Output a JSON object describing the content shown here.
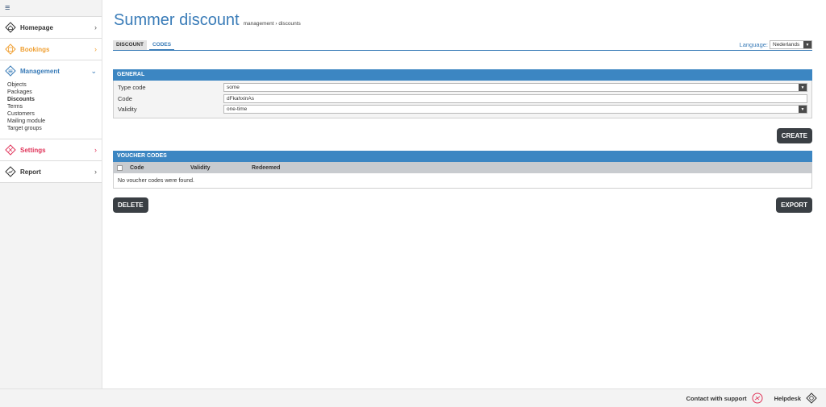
{
  "sidebar": {
    "items": [
      {
        "label": "Homepage",
        "color": "#333333",
        "icon": "home-icon"
      },
      {
        "label": "Bookings",
        "color": "#f0a033",
        "icon": "calendar-icon"
      },
      {
        "label": "Management",
        "color": "#3a7cb8",
        "icon": "management-icon",
        "subitems": [
          "Objects",
          "Packages",
          "Discounts",
          "Terms",
          "Customers",
          "Mailing module",
          "Target groups"
        ],
        "active_subitem": "Discounts"
      },
      {
        "label": "Settings",
        "color": "#e0355a",
        "icon": "settings-icon"
      },
      {
        "label": "Report",
        "color": "#333333",
        "icon": "report-icon"
      }
    ]
  },
  "header": {
    "title": "Summer discount",
    "breadcrumb": "management › discounts"
  },
  "tabs": [
    {
      "label": "DISCOUNT",
      "active": false
    },
    {
      "label": "CODES",
      "active": true
    }
  ],
  "language": {
    "label": "Language:",
    "value": "Nederlands"
  },
  "general": {
    "header": "GENERAL",
    "fields": [
      {
        "label": "Type code",
        "value": "some",
        "type": "select"
      },
      {
        "label": "Code",
        "value": "dFkahxinAs",
        "type": "input"
      },
      {
        "label": "Validity",
        "value": "one-time",
        "type": "select"
      }
    ],
    "create_label": "CREATE"
  },
  "voucher": {
    "header": "VOUCHER CODES",
    "columns": [
      "Code",
      "Validity",
      "Redeemed"
    ],
    "empty": "No voucher codes were found.",
    "delete_label": "DELETE",
    "export_label": "EXPORT"
  },
  "footer": {
    "contact": "Contact with support",
    "helpdesk": "Helpdesk"
  },
  "colors": {
    "accent": "#3a7cb8",
    "panel": "#3c86c2",
    "button": "#3a3f44"
  }
}
